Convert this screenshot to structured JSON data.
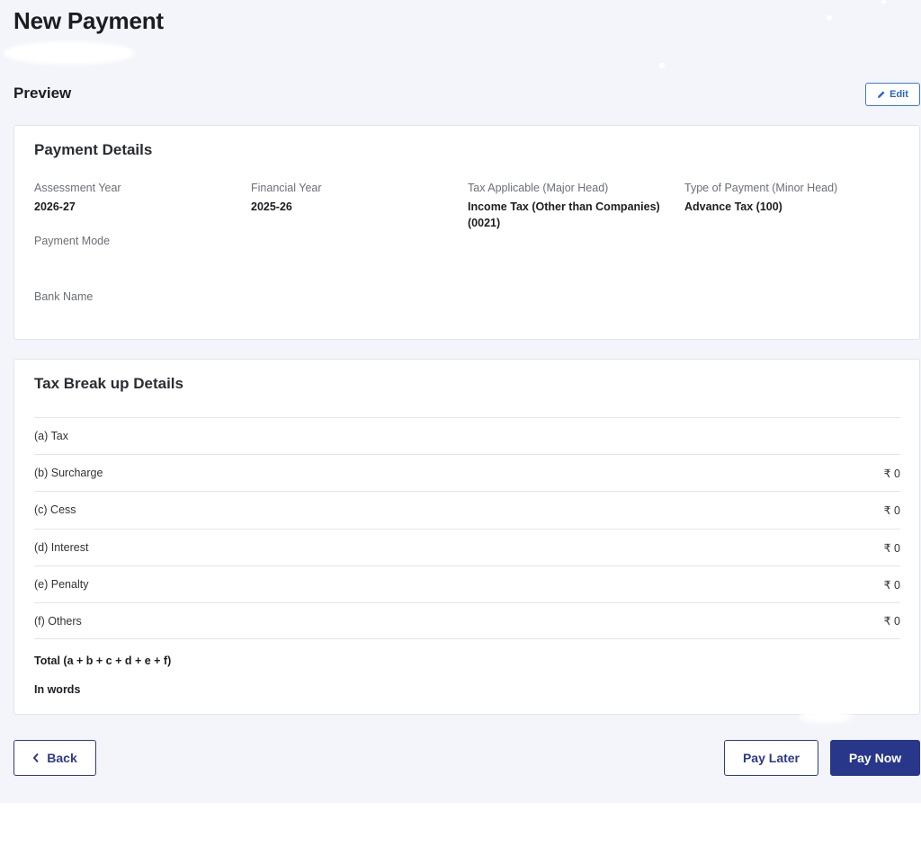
{
  "header": {
    "title": "New Payment"
  },
  "preview": {
    "title": "Preview",
    "edit_label": "Edit"
  },
  "payment_details": {
    "title": "Payment Details",
    "fields": [
      {
        "label": "Assessment Year",
        "value": "2026-27"
      },
      {
        "label": "Financial Year",
        "value": "2025-26"
      },
      {
        "label": "Tax Applicable (Major Head)",
        "value": "Income Tax (Other than Companies) (0021)"
      },
      {
        "label": "Type of Payment (Minor Head)",
        "value": "Advance Tax (100)"
      },
      {
        "label": "Payment Mode",
        "value": ""
      },
      {
        "label": "Bank Name",
        "value": ""
      }
    ]
  },
  "tax_breakup": {
    "title": "Tax Break up Details",
    "rows": [
      {
        "label": "(a) Tax",
        "amount": ""
      },
      {
        "label": "(b) Surcharge",
        "amount": "₹ 0"
      },
      {
        "label": "(c) Cess",
        "amount": "₹ 0"
      },
      {
        "label": "(d) Interest",
        "amount": "₹ 0"
      },
      {
        "label": "(e) Penalty",
        "amount": "₹ 0"
      },
      {
        "label": "(f) Others",
        "amount": "₹ 0"
      }
    ],
    "total_label": "Total (a + b + c + d + e + f)",
    "in_words_label": "In words"
  },
  "actions": {
    "back_label": "Back",
    "pay_later_label": "Pay Later",
    "pay_now_label": "Pay Now"
  },
  "colors": {
    "primary": "#28378a",
    "link": "#2566c9",
    "background": "#f4f5fa"
  },
  "icons": {
    "edit": "pencil-icon",
    "back": "chevron-left-icon"
  }
}
